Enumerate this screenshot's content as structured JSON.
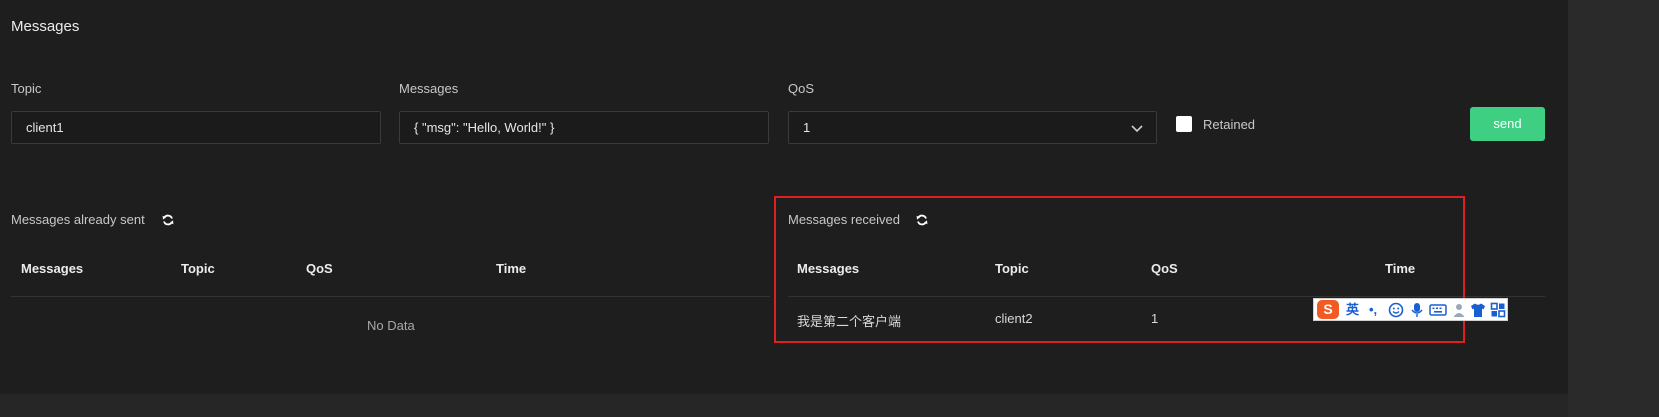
{
  "panel": {
    "title": "Messages"
  },
  "publish": {
    "topic": {
      "label": "Topic",
      "value": "client1"
    },
    "messages": {
      "label": "Messages",
      "value": "{ \"msg\": \"Hello, World!\" }"
    },
    "qos": {
      "label": "QoS",
      "value": "1"
    },
    "retained": {
      "label": "Retained",
      "checked": false
    },
    "send_label": "send"
  },
  "sent": {
    "title": "Messages already sent",
    "columns": [
      "Messages",
      "Topic",
      "QoS",
      "Time"
    ],
    "empty_text": "No Data"
  },
  "received": {
    "title": "Messages received",
    "columns": [
      "Messages",
      "Topic",
      "QoS",
      "Time"
    ],
    "rows": [
      {
        "message": "我是第二个客户端",
        "topic": "client2",
        "qos": "1",
        "time": ""
      }
    ]
  },
  "ime": {
    "lang": "英",
    "punct": "•,"
  },
  "colors": {
    "background": "#1e1e1e",
    "accent_green": "#3ecf82",
    "annotation_red": "#e02020",
    "ime_blue": "#1a5fd0",
    "ime_orange": "#f15a22"
  }
}
